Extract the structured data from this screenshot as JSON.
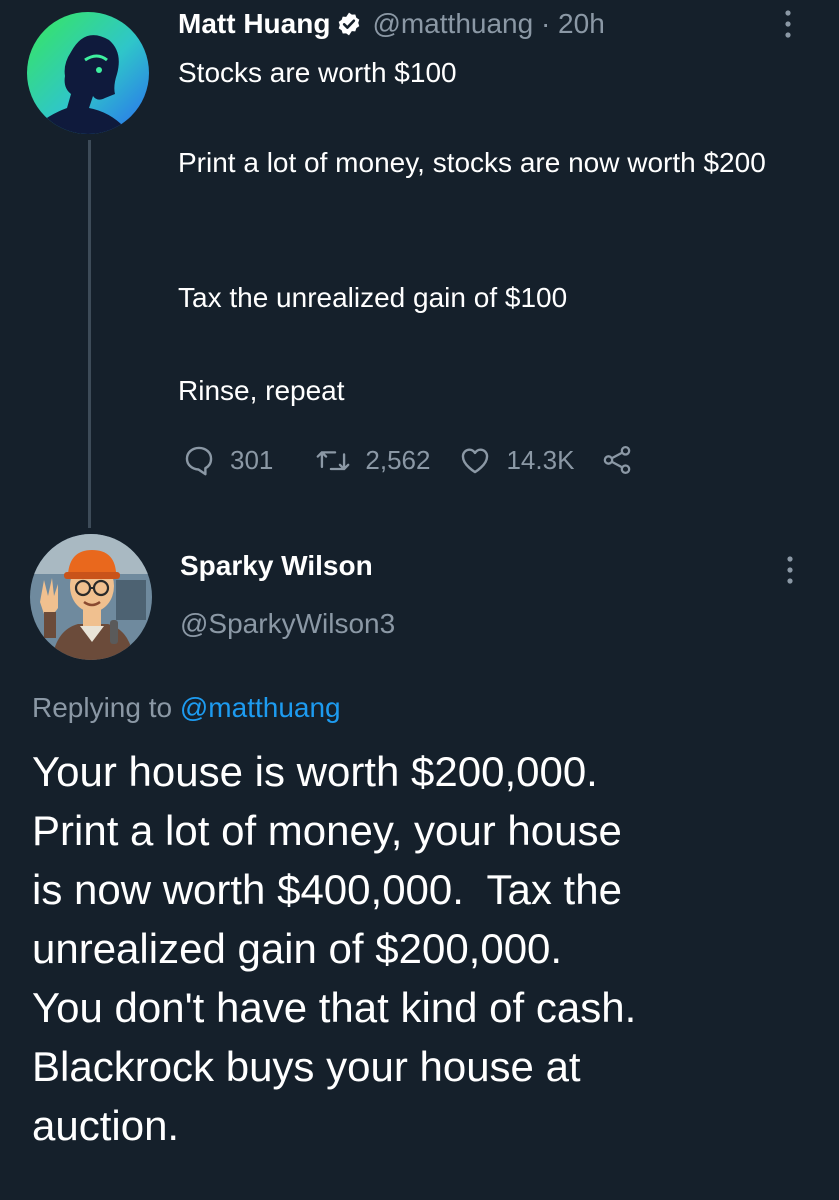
{
  "tweet": {
    "author_name": "Matt Huang",
    "handle_time": "@matthuang · 20h",
    "avatar_icon": "avatar-illustration-icon",
    "verified_icon": "verified-badge-icon",
    "more_icon": "more-vertical-icon",
    "text_lines": [
      "Stocks are worth $100",
      "Print a lot of money, stocks are now worth $200",
      "Tax the unrealized gain of $100",
      "Rinse, repeat"
    ],
    "actions": {
      "replies": "301",
      "retweets": "2,562",
      "likes": "14.3K"
    }
  },
  "reply": {
    "author_name": "Sparky Wilson",
    "handle": "@SparkyWilson3",
    "replying_to_label": "Replying to",
    "replying_to_handle": "@matthuang",
    "body_lines": [
      "Your house is worth $200,000.",
      "Print a lot of money, your house",
      "is now worth $400,000.  Tax the",
      "unrealized gain of $200,000.",
      "You don't have that kind of cash.",
      "Blackrock buys your house at",
      "auction."
    ]
  },
  "colors": {
    "background": "#15202b",
    "text_primary": "#ffffff",
    "text_secondary": "#8b98a5",
    "accent": "#1d9bf0"
  }
}
